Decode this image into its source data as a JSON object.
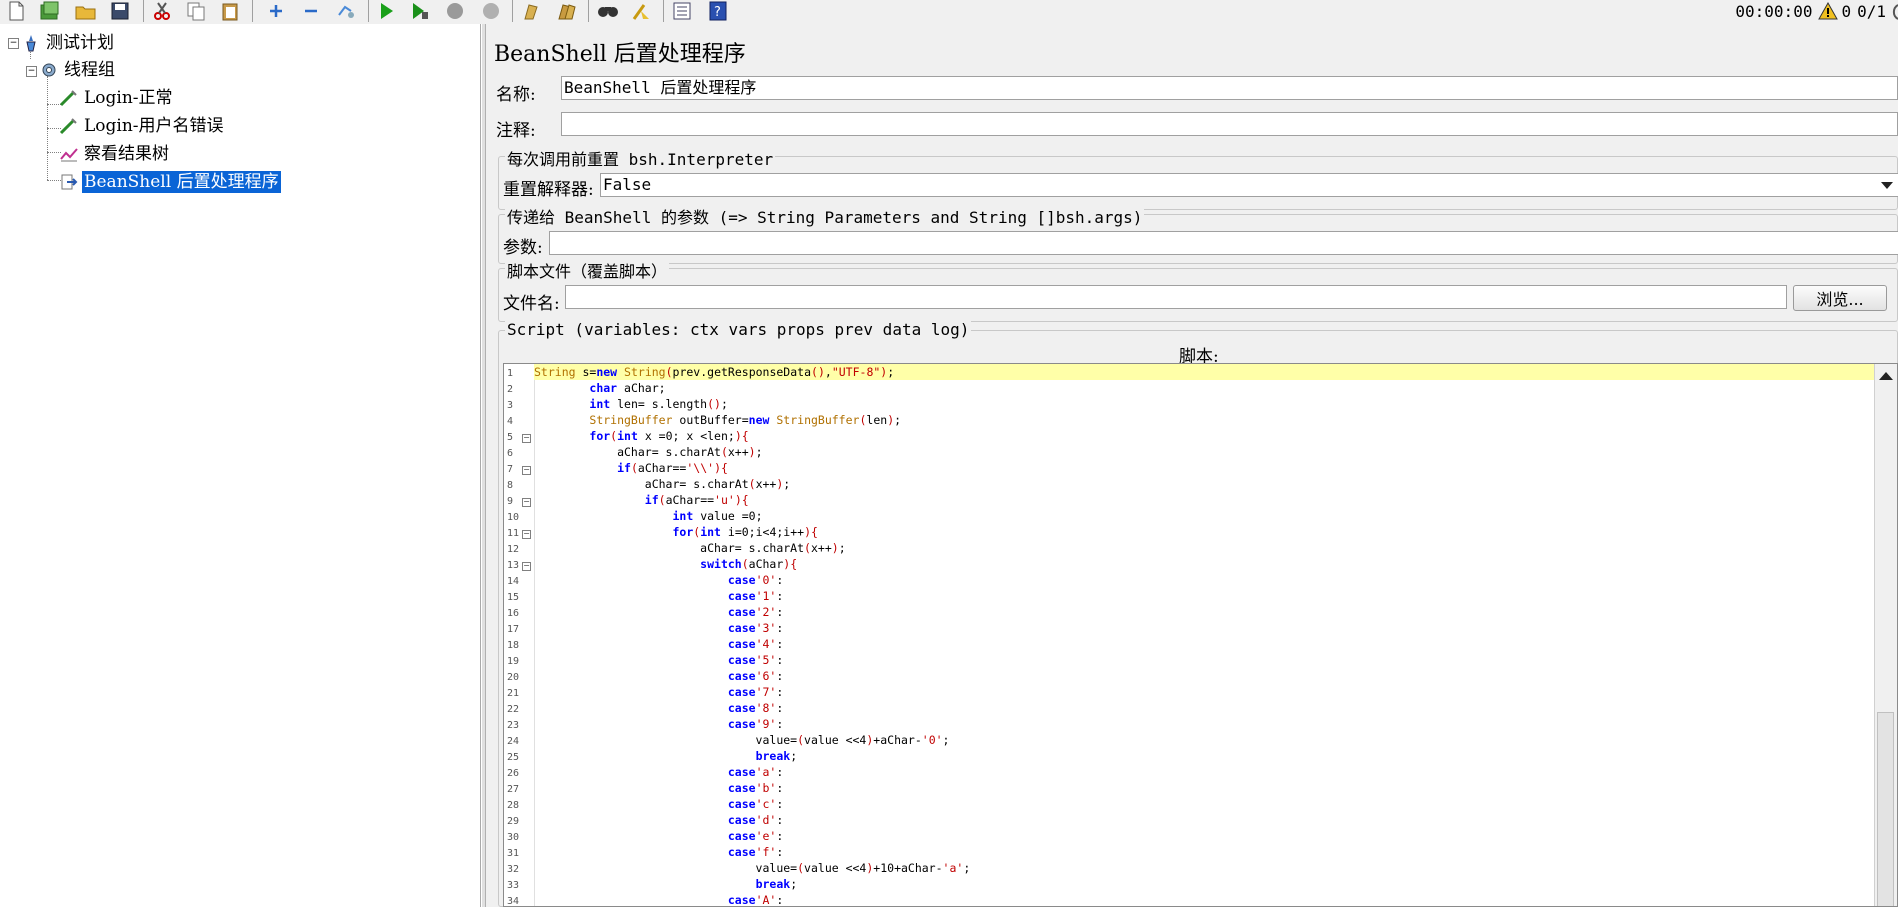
{
  "toolbar": {
    "icons": [
      "new-icon",
      "templates-icon",
      "open-icon",
      "save-icon",
      "cut-icon",
      "copy-icon",
      "paste-icon",
      "expand-icon",
      "collapse-icon",
      "toggle-icon",
      "start-icon",
      "start-no-pause-icon",
      "stop-icon",
      "shutdown-icon",
      "clear-icon",
      "clear-all-icon",
      "search-icon",
      "reset-search-icon",
      "function-helper-icon",
      "help-icon"
    ],
    "timer": "00:00:00",
    "warnings": "0",
    "threads": "0/1"
  },
  "tree": {
    "items": [
      {
        "label": "测试计划",
        "icon": "test-plan-icon"
      },
      {
        "label": "线程组",
        "icon": "thread-group-icon"
      },
      {
        "label": "Login-正常",
        "icon": "http-sampler-icon"
      },
      {
        "label": "Login-用户名错误",
        "icon": "http-sampler-icon"
      },
      {
        "label": "察看结果树",
        "icon": "listener-icon"
      },
      {
        "label": "BeanShell 后置处理程序",
        "icon": "post-processor-icon"
      }
    ]
  },
  "panel": {
    "title": "BeanShell 后置处理程序",
    "name_label": "名称:",
    "name_value": "BeanShell 后置处理程序",
    "comment_label": "注释:",
    "comment_value": "",
    "reset_group_title": "每次调用前重置 bsh.Interpreter",
    "reset_label": "重置解释器:",
    "reset_value": "False",
    "params_group_title": "传递给 BeanShell 的参数 (=> String Parameters and String []bsh.args)",
    "params_label": "参数:",
    "params_value": "",
    "file_group_title": "脚本文件（覆盖脚本）",
    "file_label": "文件名:",
    "file_value": "",
    "browse_label": "浏览...",
    "script_group_title": "Script (variables: ctx vars props prev data log)",
    "script_label": "脚本:"
  },
  "script": {
    "lines": [
      "String s=new String(prev.getResponseData(),\"UTF-8\");",
      "        char aChar;",
      "        int len= s.length();",
      "        StringBuffer outBuffer=new StringBuffer(len);",
      "        for(int x =0; x <len;){",
      "            aChar= s.charAt(x++);",
      "            if(aChar=='\\\\'){",
      "                aChar= s.charAt(x++);",
      "                if(aChar=='u'){",
      "                    int value =0;",
      "                    for(int i=0;i<4;i++){",
      "                        aChar= s.charAt(x++);",
      "                        switch(aChar){",
      "                            case'0':",
      "                            case'1':",
      "                            case'2':",
      "                            case'3':",
      "                            case'4':",
      "                            case'5':",
      "                            case'6':",
      "                            case'7':",
      "                            case'8':",
      "                            case'9':",
      "                                value=(value <<4)+aChar-'0';",
      "                                break;",
      "                            case'a':",
      "                            case'b':",
      "                            case'c':",
      "                            case'd':",
      "                            case'e':",
      "                            case'f':",
      "                                value=(value <<4)+10+aChar-'a';",
      "                                break;",
      "                            case'A':"
    ],
    "fold_lines": [
      5,
      7,
      9,
      11,
      13
    ]
  }
}
